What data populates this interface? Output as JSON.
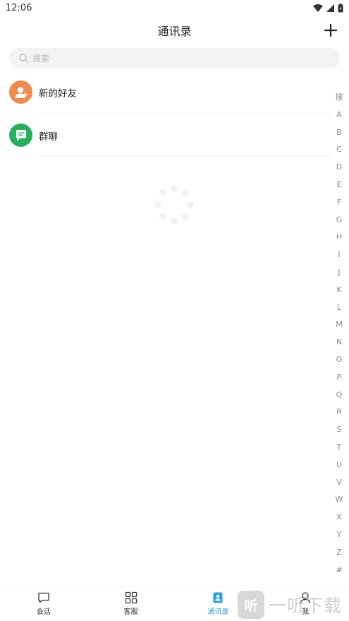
{
  "status_bar": {
    "time": "12:06",
    "icons": [
      "wifi-icon",
      "signal-icon",
      "battery-icon"
    ]
  },
  "header": {
    "title": "通讯录",
    "add_icon": "plus-icon"
  },
  "search": {
    "placeholder": "搜索",
    "icon": "search-icon"
  },
  "contacts": [
    {
      "label": "新的好友",
      "icon": "add-friend-icon",
      "color": "#f28a4e"
    },
    {
      "label": "群聊",
      "icon": "group-chat-icon",
      "color": "#27b05c"
    }
  ],
  "index_letters": [
    "搜",
    "A",
    "B",
    "C",
    "D",
    "E",
    "F",
    "G",
    "H",
    "I",
    "J",
    "K",
    "L",
    "M",
    "N",
    "O",
    "P",
    "Q",
    "R",
    "S",
    "T",
    "U",
    "V",
    "W",
    "X",
    "Y",
    "Z",
    "#"
  ],
  "tabs": [
    {
      "label": "会话",
      "icon": "chat-bubble-icon",
      "active": false
    },
    {
      "label": "客服",
      "icon": "grid-icon",
      "active": false
    },
    {
      "label": "通讯录",
      "icon": "contacts-icon",
      "active": true
    },
    {
      "label": "我",
      "icon": "person-icon",
      "active": false
    }
  ],
  "colors": {
    "accent": "#2aa1e6",
    "new_friend": "#f28a4e",
    "group_chat": "#27b05c"
  },
  "watermark": {
    "logo_char": "听",
    "text": "一听下载"
  }
}
